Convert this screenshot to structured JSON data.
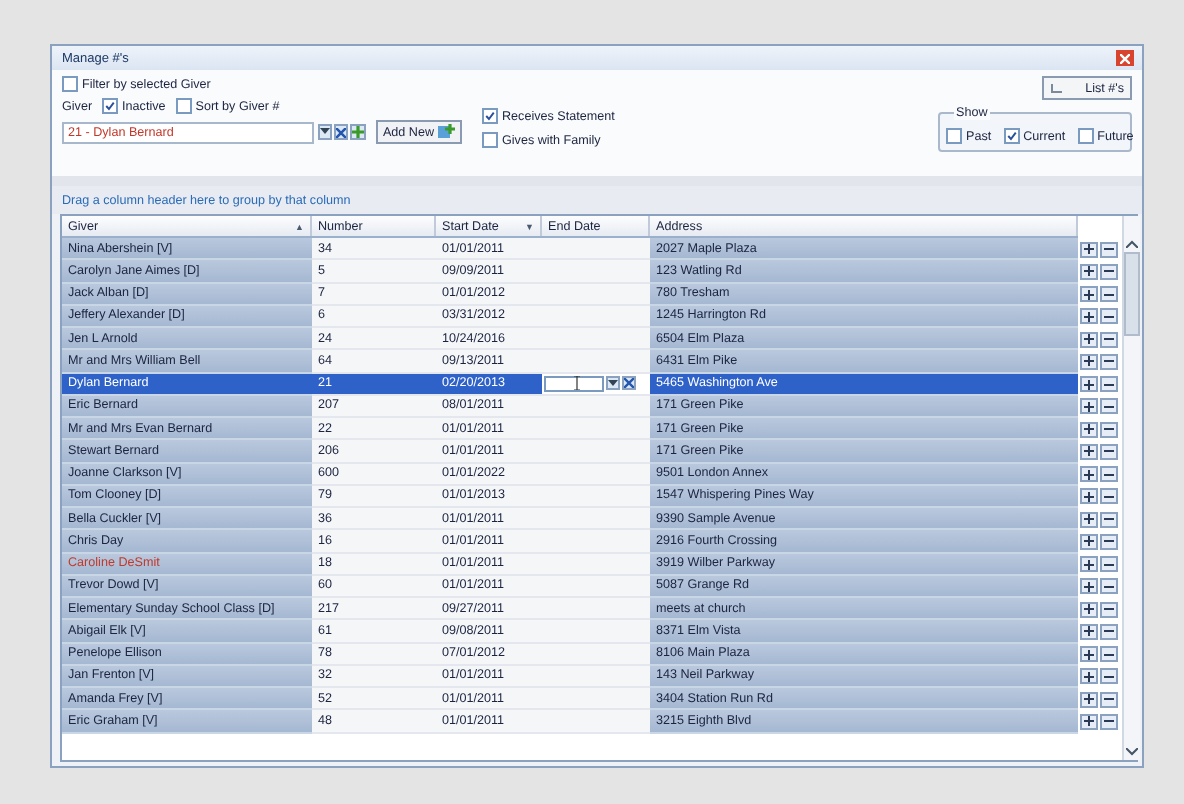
{
  "window": {
    "title": "Manage #'s"
  },
  "filter_checkbox": {
    "label": "Filter by selected Giver",
    "checked": false
  },
  "giver_label": "Giver",
  "giver_options": [
    {
      "label": "Inactive",
      "checked": true
    },
    {
      "label": "Sort by Giver #",
      "checked": false
    }
  ],
  "giver_field": {
    "value": "21 - Dylan Bernard"
  },
  "add_new_button": "Add New",
  "statement_options": [
    {
      "label": "Receives Statement",
      "checked": true
    },
    {
      "label": "Gives with Family",
      "checked": false
    }
  ],
  "list_button": "List #'s",
  "show_group": {
    "title": "Show",
    "options": [
      {
        "label": "Past",
        "checked": false
      },
      {
        "label": "Current",
        "checked": true
      },
      {
        "label": "Future",
        "checked": false
      }
    ]
  },
  "group_hint": "Drag a column header here to group by that column",
  "table": {
    "columns": [
      {
        "label": "Giver",
        "sort_mark": "▲"
      },
      {
        "label": "Number"
      },
      {
        "label": "Start Date",
        "sort_mark": "▼"
      },
      {
        "label": "End Date"
      },
      {
        "label": "Address"
      }
    ],
    "rows": [
      {
        "giver": "Nina Abershein [V]",
        "number": "34",
        "start_date": "01/01/2011",
        "address": "2027 Maple Plaza",
        "selected": false,
        "inactive": false
      },
      {
        "giver": "Carolyn Jane Aimes [D]",
        "number": "5",
        "start_date": "09/09/2011",
        "address": "123 Watling Rd",
        "selected": false,
        "inactive": false
      },
      {
        "giver": "Jack Alban [D]",
        "number": "7",
        "start_date": "01/01/2012",
        "address": "780 Tresham",
        "selected": false,
        "inactive": false
      },
      {
        "giver": "Jeffery Alexander [D]",
        "number": "6",
        "start_date": "03/31/2012",
        "address": "1245 Harrington Rd",
        "selected": false,
        "inactive": false
      },
      {
        "giver": "Jen L Arnold",
        "number": "24",
        "start_date": "10/24/2016",
        "address": "6504 Elm Plaza",
        "selected": false,
        "inactive": false
      },
      {
        "giver": "Mr and Mrs William Bell",
        "number": "64",
        "start_date": "09/13/2011",
        "address": "6431 Elm Pike",
        "selected": false,
        "inactive": false
      },
      {
        "giver": "Dylan Bernard",
        "number": "21",
        "start_date": "02/20/2013",
        "address": "5465 Washington Ave",
        "selected": true,
        "inactive": false
      },
      {
        "giver": "Eric Bernard",
        "number": "207",
        "start_date": "08/01/2011",
        "address": "171 Green Pike",
        "selected": false,
        "inactive": false
      },
      {
        "giver": "Mr and Mrs Evan Bernard",
        "number": "22",
        "start_date": "01/01/2011",
        "address": "171 Green Pike",
        "selected": false,
        "inactive": false
      },
      {
        "giver": "Stewart Bernard",
        "number": "206",
        "start_date": "01/01/2011",
        "address": "171 Green Pike",
        "selected": false,
        "inactive": false
      },
      {
        "giver": "Joanne Clarkson [V]",
        "number": "600",
        "start_date": "01/01/2022",
        "address": "9501 London Annex",
        "selected": false,
        "inactive": false
      },
      {
        "giver": "Tom Clooney [D]",
        "number": "79",
        "start_date": "01/01/2013",
        "address": "1547 Whispering Pines Way",
        "selected": false,
        "inactive": false
      },
      {
        "giver": "Bella Cuckler [V]",
        "number": "36",
        "start_date": "01/01/2011",
        "address": "9390 Sample Avenue",
        "selected": false,
        "inactive": false
      },
      {
        "giver": "Chris Day",
        "number": "16",
        "start_date": "01/01/2011",
        "address": "2916 Fourth Crossing",
        "selected": false,
        "inactive": false
      },
      {
        "giver": "Caroline DeSmit",
        "number": "18",
        "start_date": "01/01/2011",
        "address": "3919 Wilber Parkway",
        "selected": false,
        "inactive": true
      },
      {
        "giver": "Trevor Dowd [V]",
        "number": "60",
        "start_date": "01/01/2011",
        "address": "5087 Grange Rd",
        "selected": false,
        "inactive": false
      },
      {
        "giver": "Elementary Sunday School Class [D]",
        "number": "217",
        "start_date": "09/27/2011",
        "address": "meets at church",
        "selected": false,
        "inactive": false
      },
      {
        "giver": "Abigail Elk [V]",
        "number": "61",
        "start_date": "09/08/2011",
        "address": "8371 Elm Vista",
        "selected": false,
        "inactive": false
      },
      {
        "giver": "Penelope Ellison",
        "number": "78",
        "start_date": "07/01/2012",
        "address": "8106 Main Plaza",
        "selected": false,
        "inactive": false
      },
      {
        "giver": "Jan Frenton [V]",
        "number": "32",
        "start_date": "01/01/2011",
        "address": "143 Neil Parkway",
        "selected": false,
        "inactive": false
      },
      {
        "giver": "Amanda Frey [V]",
        "number": "52",
        "start_date": "01/01/2011",
        "address": "3404 Station Run Rd",
        "selected": false,
        "inactive": false
      },
      {
        "giver": "Eric Graham [V]",
        "number": "48",
        "start_date": "01/01/2011",
        "address": "3215 Eighth Blvd",
        "selected": false,
        "inactive": false
      }
    ]
  }
}
